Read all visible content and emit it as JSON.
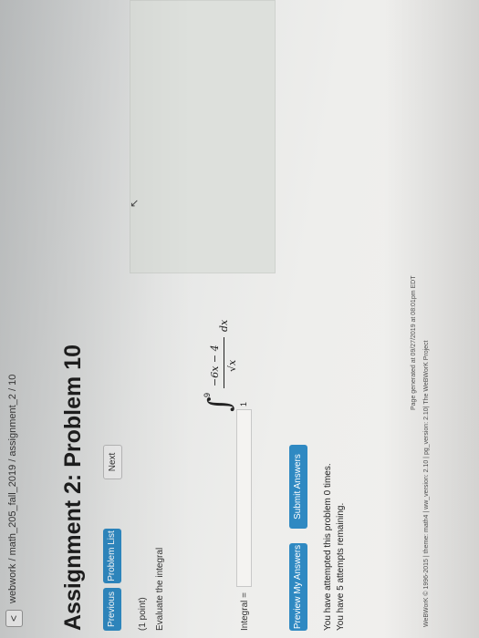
{
  "nav": {
    "back_glyph": "<",
    "breadcrumb": "webwork / math_205_fall_2019 / assignment_2 / 10"
  },
  "problem": {
    "title": "Assignment 2: Problem 10",
    "points": "(1 point)",
    "instruction": "Evaluate the integral",
    "integral": {
      "upper": "9",
      "lower": "1",
      "numerator": "−6x − 4",
      "denominator": "√x",
      "differential": "dx"
    },
    "answer_label": "Integral =",
    "answer_value": ""
  },
  "buttons": {
    "previous": "Previous",
    "problem_list": "Problem List",
    "next": "Next",
    "preview": "Preview My Answers",
    "submit": "Submit Answers"
  },
  "status": {
    "attempts": "You have attempted this problem 0 times.",
    "remaining": "You have 5 attempts remaining."
  },
  "footer": {
    "generated": "Page generated at 09/27/2019 at 08:01pm EDT",
    "copyright": "WeBWorK © 1996-2015 | theme: math4 | ww_version: 2.10 | pg_version: 2.10| The WeBWorK Project"
  },
  "colors": {
    "button_primary": "#2f89c2",
    "panel": "#dde0dc"
  }
}
